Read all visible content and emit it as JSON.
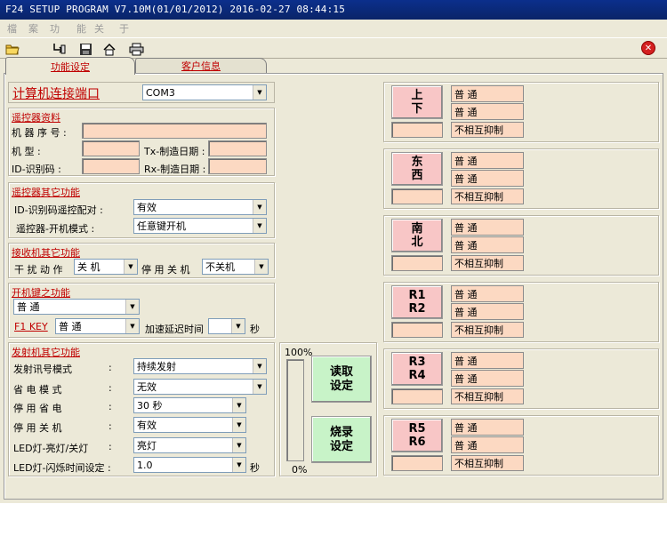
{
  "window": {
    "title": "F24 SETUP PROGRAM V7.10M(01/01/2012)  2016-02-27  08:44:15"
  },
  "menu": [
    "檔",
    "案",
    "功",
    "能",
    "关",
    "于"
  ],
  "toolbar": {
    "icons": [
      "open-folder-icon",
      "import-icon",
      "save-icon",
      "home-icon",
      "print-icon",
      "close-icon"
    ]
  },
  "tabs": [
    {
      "label": "功能设定",
      "active": true
    },
    {
      "label": "客户信息",
      "active": false
    }
  ],
  "port": {
    "label": "计算机连接端口",
    "value": "COM3"
  },
  "remote_info": {
    "title": "遥控器资料",
    "serial_label": "机 器 序 号 :",
    "model_label": "机      型 :",
    "tx_date_label": "Tx-制造日期 :",
    "id_label": "ID-识别码 :",
    "rx_date_label": "Rx-制造日期 :"
  },
  "remote_other": {
    "title": "遥控器其它功能",
    "id_pair_label": "ID-识别码遥控配对    :",
    "id_pair_value": "有效",
    "power_mode_label": "遥控器-开机模式    :",
    "power_mode_value": "任意键开机"
  },
  "receiver_other": {
    "title": "接收机其它功能",
    "interference_label": "干 扰 动 作",
    "interference_value": "关  机",
    "stop_label": "停 用 关 机",
    "stop_value": "不关机"
  },
  "power_key": {
    "title": "开机键之功能",
    "mode_value": "普      通",
    "f1_label": "F1 KEY",
    "f1_value": "普      通",
    "accel_label": "加速延迟时间",
    "accel_value": "",
    "accel_unit": "秒"
  },
  "transmitter_other": {
    "title": "发射机其它功能",
    "rows": [
      {
        "label": "发射讯号模式",
        "colon": ":",
        "value": "持续发射"
      },
      {
        "label": "省 电 模 式",
        "colon": ":",
        "value": "无效"
      },
      {
        "label": "停 用 省 电",
        "colon": ":",
        "value": "30 秒"
      },
      {
        "label": "停 用 关 机",
        "colon": ":",
        "value": "有效"
      },
      {
        "label": "LED灯-亮灯/关灯",
        "colon": ":",
        "value": "亮灯"
      },
      {
        "label": "LED灯-闪烁时间设定 :",
        "colon": "",
        "value": "1.0",
        "unit": "秒"
      }
    ]
  },
  "progress": {
    "top_label": "100%",
    "bottom_label": "0%",
    "value_percent": 0
  },
  "actions": {
    "read_line1": "读取",
    "read_line2": "设定",
    "burn_line1": "烧录",
    "burn_line2": "设定"
  },
  "directions": [
    {
      "line1": "上",
      "line2": "下",
      "a": "普      通",
      "b": "普      通",
      "c": "不相互抑制"
    },
    {
      "line1": "东",
      "line2": "西",
      "a": "普      通",
      "b": "普      通",
      "c": "不相互抑制"
    },
    {
      "line1": "南",
      "line2": "北",
      "a": "普      通",
      "b": "普      通",
      "c": "不相互抑制"
    },
    {
      "line1": "R1",
      "line2": "R2",
      "a": "普      通",
      "b": "普      通",
      "c": "不相互抑制"
    },
    {
      "line1": "R3",
      "line2": "R4",
      "a": "普      通",
      "b": "普      通",
      "c": "不相互抑制"
    },
    {
      "line1": "R5",
      "line2": "R6",
      "a": "普      通",
      "b": "普      通",
      "c": "不相互抑制"
    }
  ],
  "colors": {
    "accent_red": "#c00000",
    "field_peach": "#fcd9c2",
    "button_pink": "#f8c6c6",
    "button_green": "#c8f3c8",
    "titlebar_blue": "#0b2f8c"
  }
}
